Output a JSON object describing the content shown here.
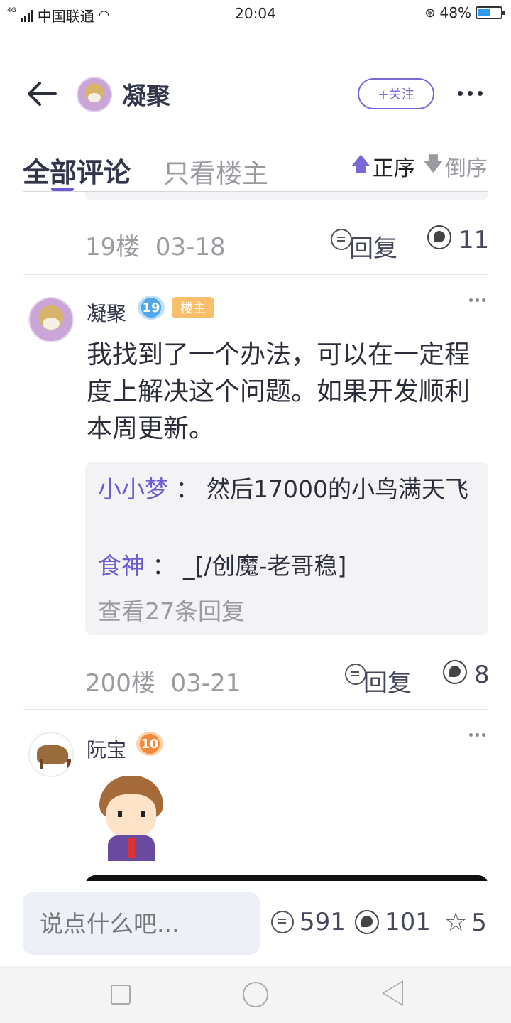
{
  "status_bar": {
    "network": "4G",
    "carrier": "中国联通",
    "time": "20:04",
    "battery": "48%",
    "battery_level": 0.48
  },
  "header": {
    "title": "凝聚",
    "follow_label": "+关注"
  },
  "tabs": {
    "all_comments": "全部评论",
    "owner_only": "只看楼主",
    "sort_asc": "正序",
    "sort_desc": "倒序"
  },
  "floors": [
    {
      "floor": "19楼",
      "date": "03-18",
      "reply_label": "回复",
      "likes": "11"
    },
    {
      "user": "凝聚",
      "level": "19",
      "badge": "楼主",
      "content": "我找到了一个办法，可以在一定程度上解决这个问题。如果开发顺利本周更新。",
      "replies": [
        {
          "name": "小小梦",
          "sep": "：",
          "text": "然后17000的小鸟满天飞"
        },
        {
          "name": "食神",
          "sep": "：",
          "text": "_[/创魔-老哥稳]"
        }
      ],
      "view_more": "查看27条回复",
      "floor": "200楼",
      "date": "03-21",
      "reply_label": "回复",
      "likes": "8"
    },
    {
      "user": "阮宝",
      "level": "10"
    }
  ],
  "bottom_bar": {
    "input_placeholder": "说点什么吧...",
    "comment_count": "591",
    "like_count": "101",
    "star_count": "5"
  },
  "colors": {
    "accent": "#6b5bd3",
    "owner_badge": "#fbbf6b",
    "level_blue": "#4fa8ee",
    "level_orange": "#f08a3c"
  }
}
